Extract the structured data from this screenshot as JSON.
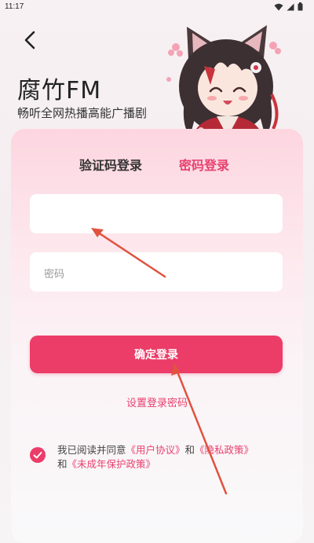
{
  "status_bar": {
    "time": "11:17"
  },
  "header": {
    "title": "腐竹FM",
    "subtitle": "畅听全网热播高能广播剧"
  },
  "tabs": {
    "sms_login": "验证码登录",
    "password_login": "密码登录"
  },
  "form": {
    "phone_value": "",
    "password_placeholder": "密码",
    "confirm_label": "确定登录",
    "set_password_label": "设置登录密码"
  },
  "agreement": {
    "prefix": "我已阅读并同意",
    "user_agreement": "《用户协议》",
    "and1": "和",
    "privacy_policy": "《隐私政策》",
    "and2": "和",
    "minor_policy": "《未成年保护政策》"
  },
  "colors": {
    "accent": "#ec3c68",
    "accent_text": "#e8416f",
    "annotation_arrow": "#e0533f"
  },
  "icons": [
    "back-icon",
    "wifi-icon",
    "signal-icon",
    "battery-icon",
    "check-icon"
  ]
}
